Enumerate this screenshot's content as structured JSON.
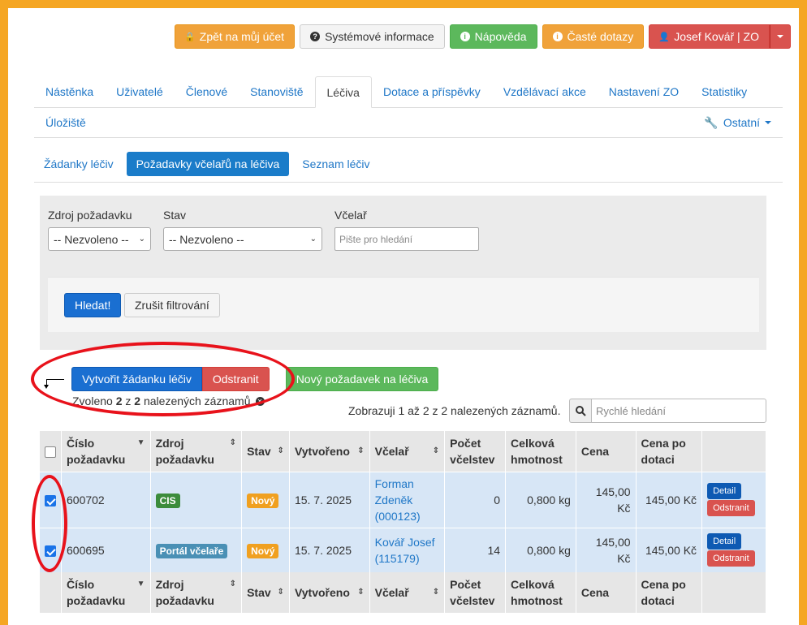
{
  "topbar": {
    "back": "Zpět na můj účet",
    "sysinfo": "Systémové informace",
    "help": "Nápověda",
    "faq": "Časté dotazy",
    "user": "Josef Kovář | ZO"
  },
  "nav": {
    "items": [
      "Nástěnka",
      "Uživatelé",
      "Členové",
      "Stanoviště",
      "Léčiva",
      "Dotace a příspěvky",
      "Vzdělávací akce",
      "Nastavení ZO",
      "Statistiky"
    ],
    "storage": "Úložiště",
    "other": "Ostatní"
  },
  "subnav": [
    "Žádanky léčiv",
    "Požadavky včelařů na léčiva",
    "Seznam léčiv"
  ],
  "filter": {
    "source_label": "Zdroj požadavku",
    "source_value": "-- Nezvoleno --",
    "state_label": "Stav",
    "state_value": "-- Nezvoleno --",
    "beekeeper_label": "Včelař",
    "beekeeper_placeholder": "Pište pro hledání",
    "search_btn": "Hledat!",
    "reset_btn": "Zrušit filtrování"
  },
  "actions": {
    "create": "Vytvořit žádanku léčiv",
    "remove": "Odstranit",
    "new_request": "Nový požadavek na léčiva"
  },
  "selection": {
    "prefix": "Zvoleno",
    "selected": "2",
    "of": "z",
    "total": "2",
    "suffix": "nalezených záznamů"
  },
  "listing": {
    "showing": "Zobrazuji 1 až 2 z 2 nalezených záznamů.",
    "quick_search_placeholder": "Rychlé hledání"
  },
  "table": {
    "headers": [
      "Číslo požadavku",
      "Zdroj požadavku",
      "Stav",
      "Vytvořeno",
      "Včelař",
      "Počet včelstev",
      "Celková hmotnost",
      "Cena",
      "Cena po dotaci"
    ],
    "rows": [
      {
        "number": "600702",
        "source": "CIS",
        "state": "Nový",
        "created": "15. 7. 2025",
        "beekeeper": "Forman Zdeněk (000123)",
        "colonies": "0",
        "weight": "0,800 kg",
        "price": "145,00 Kč",
        "price_after": "145,00 Kč",
        "checked": true
      },
      {
        "number": "600695",
        "source": "Portál včelaře",
        "state": "Nový",
        "created": "15. 7. 2025",
        "beekeeper": "Kovář Josef (115179)",
        "colonies": "14",
        "weight": "0,800 kg",
        "price": "145,00 Kč",
        "price_after": "145,00 Kč",
        "checked": true
      }
    ],
    "detail_btn": "Detail",
    "remove_btn": "Odstranit"
  },
  "colors": {
    "frame": "#f5a623",
    "annotation": "#e8121b",
    "primary": "#1a6fd1",
    "danger": "#d9534f",
    "success": "#5cb85c",
    "warning": "#f0a23a"
  }
}
